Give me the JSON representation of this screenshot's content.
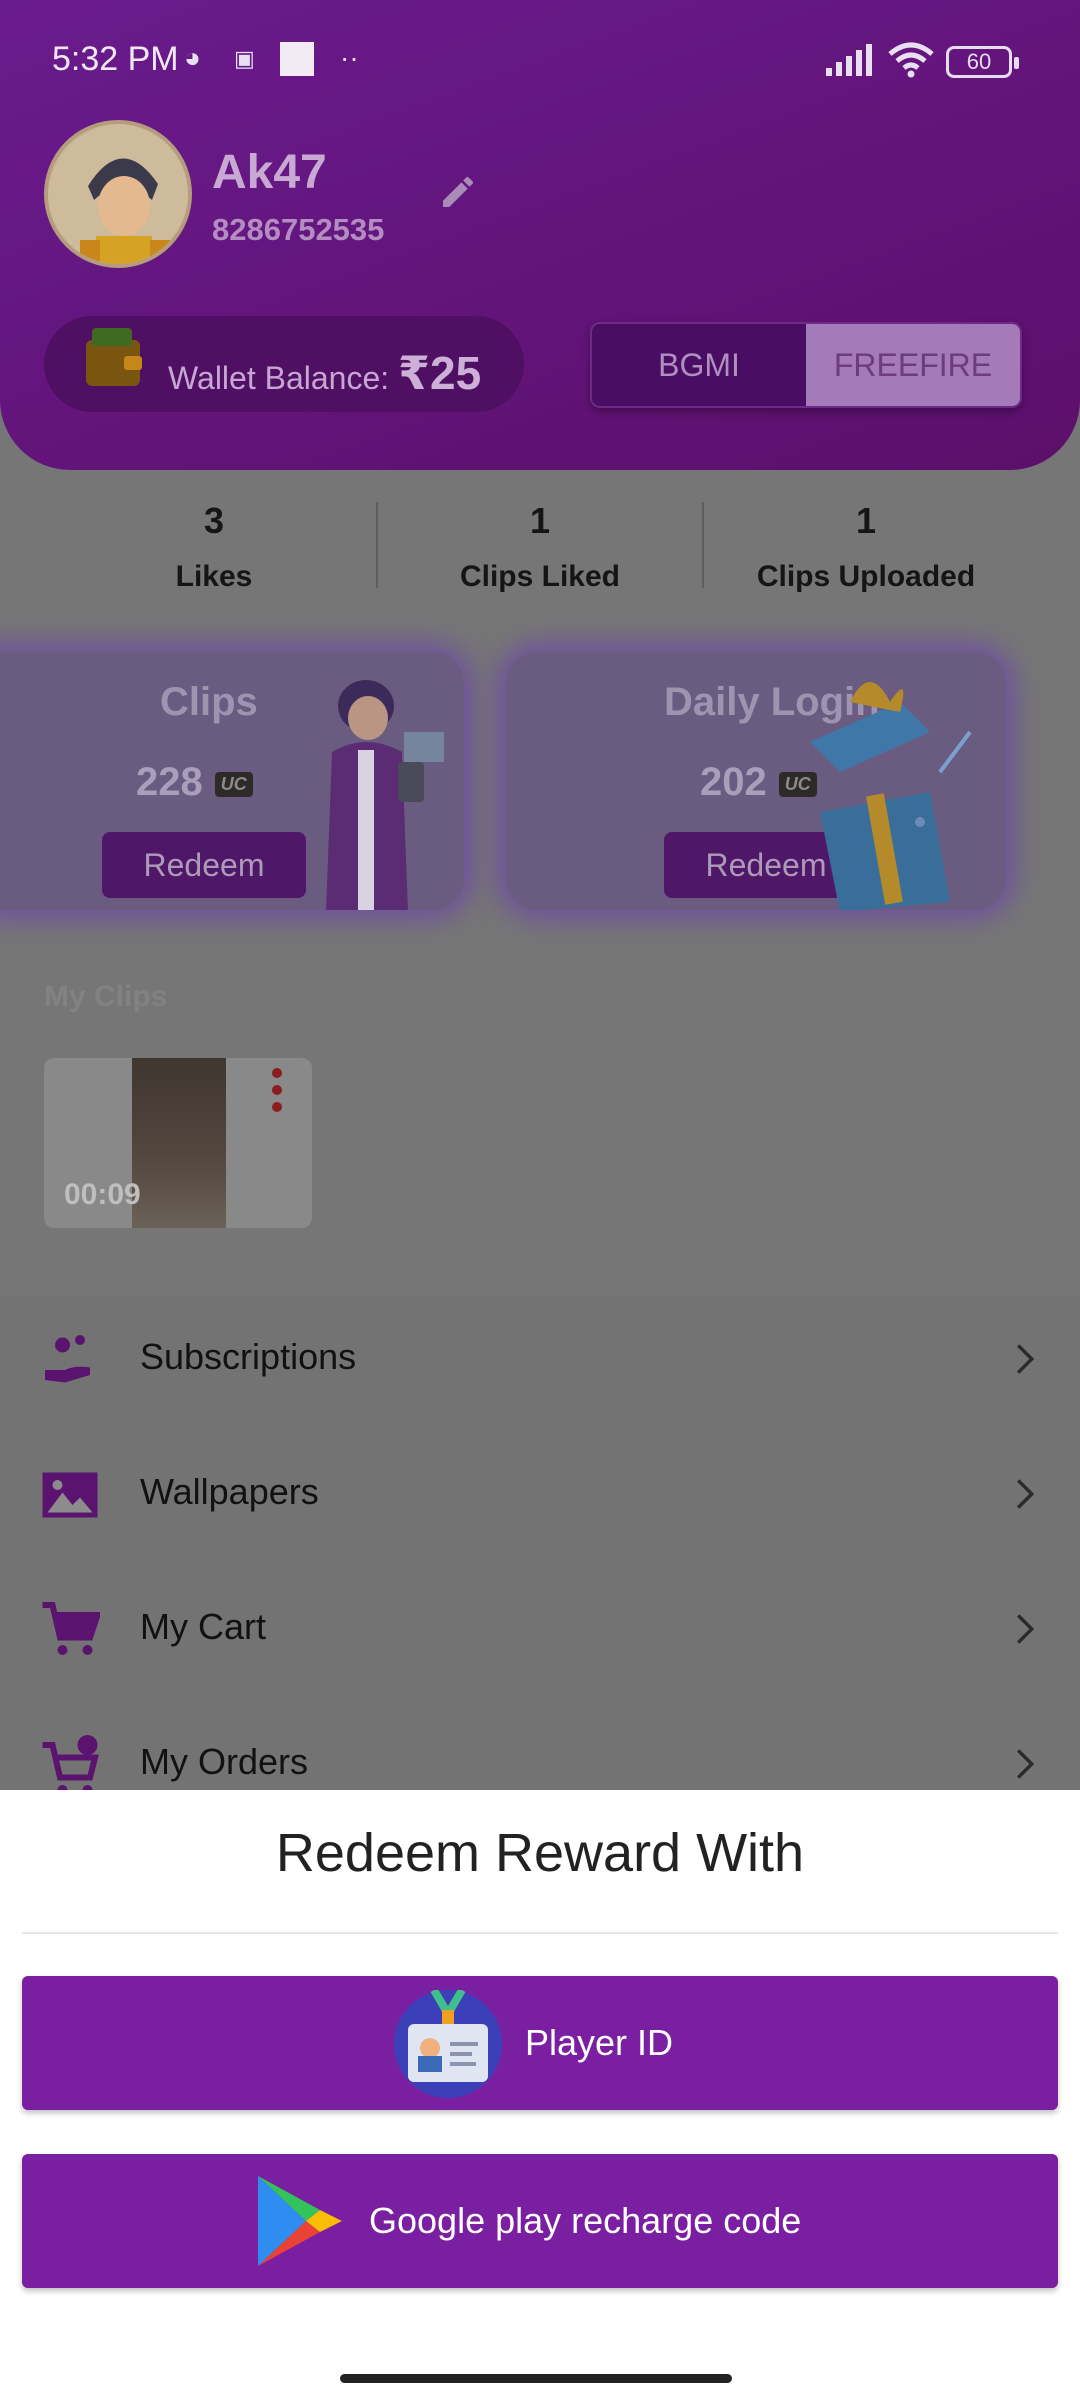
{
  "status_bar": {
    "time": "5:32 PM",
    "battery": "60"
  },
  "profile": {
    "username": "Ak47",
    "phone": "8286752535"
  },
  "wallet": {
    "label": "Wallet Balance: ",
    "amount": "₹25"
  },
  "game_toggle": {
    "options": [
      "BGMI",
      "FREEFIRE"
    ],
    "selected": "FREEFIRE"
  },
  "stats": [
    {
      "value": "3",
      "label": "Likes"
    },
    {
      "value": "1",
      "label": "Clips Liked"
    },
    {
      "value": "1",
      "label": "Clips Uploaded"
    }
  ],
  "cards": [
    {
      "title": "Clips",
      "amount": "228",
      "badge": "UC",
      "button": "Redeem"
    },
    {
      "title": "Daily Login",
      "amount": "202",
      "badge": "UC",
      "button": "Redeem"
    }
  ],
  "my_clips": {
    "label": "My Clips",
    "items": [
      {
        "duration": "00:09"
      }
    ]
  },
  "menu": [
    {
      "label": "Subscriptions",
      "icon": "subscriptions-icon"
    },
    {
      "label": "Wallpapers",
      "icon": "wallpaper-icon"
    },
    {
      "label": "My Cart",
      "icon": "cart-icon"
    },
    {
      "label": "My Orders",
      "icon": "orders-icon"
    }
  ],
  "sheet": {
    "title": "Redeem Reward With",
    "options": [
      {
        "label": "Player ID",
        "icon": "id-card-icon"
      },
      {
        "label": "Google play recharge code",
        "icon": "google-play-icon"
      }
    ]
  },
  "colors": {
    "primary": "#7b1fa2",
    "header": "#5c0f6a",
    "overlay": "#767676"
  }
}
